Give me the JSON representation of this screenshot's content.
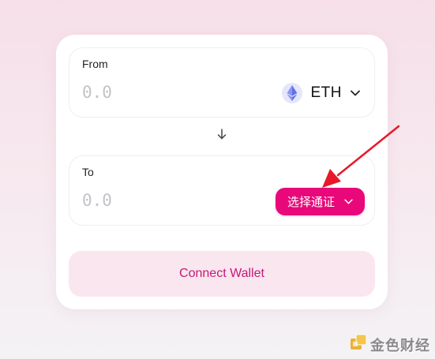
{
  "swap": {
    "from": {
      "label": "From",
      "amount_placeholder": "0.0",
      "token": "ETH",
      "token_icon": "ethereum-icon"
    },
    "to": {
      "label": "To",
      "amount_placeholder": "0.0",
      "select_label": "选择通证"
    },
    "connect_label": "Connect Wallet"
  },
  "watermark": {
    "text": "金色财经"
  },
  "colors": {
    "accent": "#e8087a",
    "connect_bg": "#fae6ee",
    "connect_text": "#c3197a",
    "annotation": "#e8182a"
  }
}
